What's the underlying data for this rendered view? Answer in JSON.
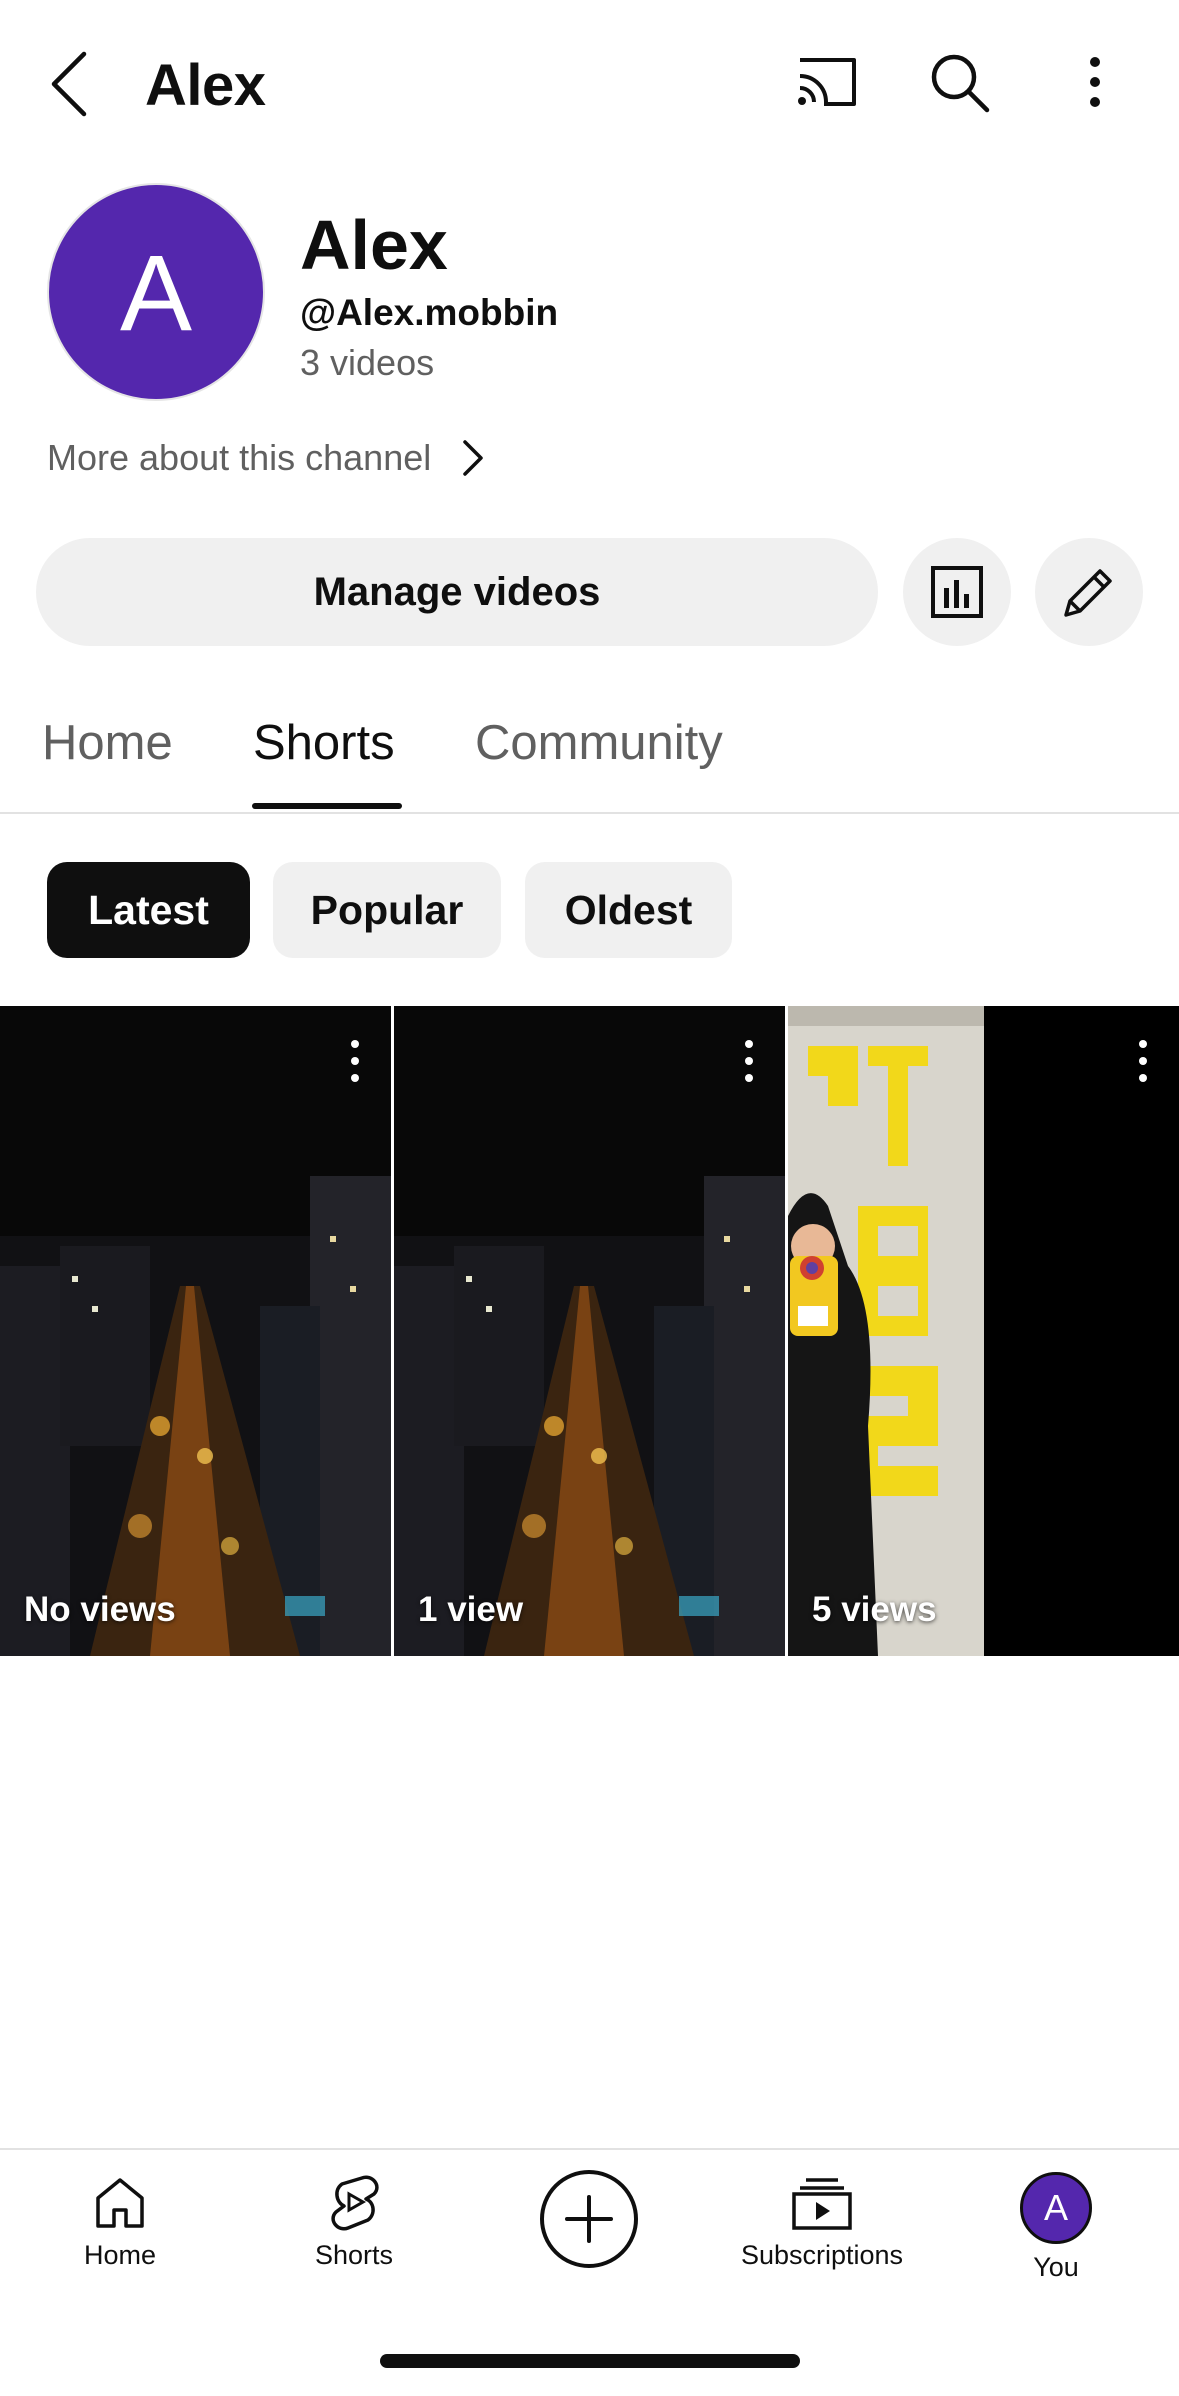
{
  "header": {
    "title": "Alex",
    "icons": [
      "back-icon",
      "cast-icon",
      "search-icon",
      "more-vertical-icon"
    ]
  },
  "channel": {
    "avatar_letter": "A",
    "name": "Alex",
    "handle": "@Alex.mobbin",
    "video_count": "3 videos",
    "more_about": "More about this channel",
    "avatar_color": "#5427ad"
  },
  "actions": {
    "manage_videos": "Manage videos",
    "icons": [
      "analytics-icon",
      "edit-pencil-icon"
    ]
  },
  "tabs": [
    {
      "label": "Home",
      "active": false
    },
    {
      "label": "Shorts",
      "active": true
    },
    {
      "label": "Community",
      "active": false
    }
  ],
  "chips": [
    {
      "label": "Latest",
      "active": true
    },
    {
      "label": "Popular",
      "active": false
    },
    {
      "label": "Oldest",
      "active": false
    }
  ],
  "shorts": [
    {
      "views": "No views",
      "thumbnail": "night-city-street"
    },
    {
      "views": "1 view",
      "thumbnail": "night-city-street"
    },
    {
      "views": "5 views",
      "thumbnail": "person-yellow-letters"
    }
  ],
  "bottom_nav": [
    {
      "label": "Home",
      "icon": "home-icon"
    },
    {
      "label": "Shorts",
      "icon": "shorts-icon"
    },
    {
      "label": "",
      "icon": "create-plus-icon"
    },
    {
      "label": "Subscriptions",
      "icon": "subscriptions-icon"
    },
    {
      "label": "You",
      "icon": "you-avatar",
      "avatar_letter": "A"
    }
  ]
}
